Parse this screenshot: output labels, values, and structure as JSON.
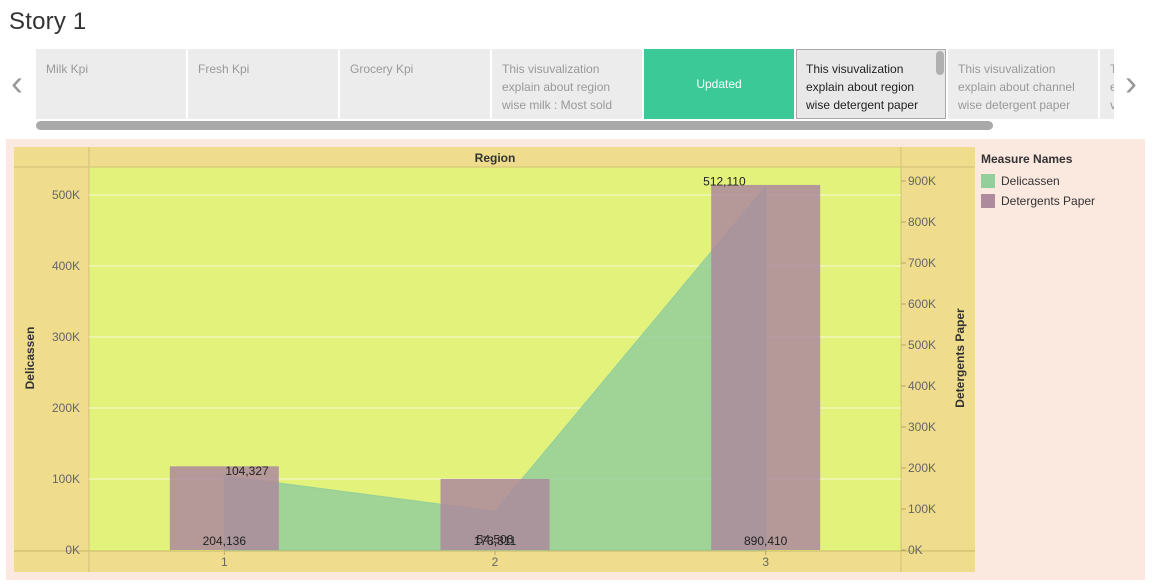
{
  "page": {
    "title": "Story 1"
  },
  "navigator": {
    "prev_icon": "chevron-left-icon",
    "next_icon": "chevron-right-icon",
    "points": [
      {
        "label": "Milk Kpi",
        "state": "normal"
      },
      {
        "label": "Fresh Kpi",
        "state": "normal"
      },
      {
        "label": "Grocery Kpi",
        "state": "normal"
      },
      {
        "label": "This visuvalization explain about  region wise milk : Most sold",
        "state": "normal"
      },
      {
        "label": "Updated",
        "state": "active"
      },
      {
        "label": "This visuvalization explain about  region wise  detergent paper",
        "state": "selected"
      },
      {
        "label": "This visuvalization explain about  channel wise detergent paper",
        "state": "normal"
      },
      {
        "label": "T e v",
        "state": "normal"
      }
    ]
  },
  "colors": {
    "plot_bg": "#e2f27a",
    "axis_bg": "#efdc8c",
    "delicassen": "#93cf9b",
    "detergents": "#ad8a9e",
    "active_point": "#3cc998",
    "dashboard_bg": "#fbe8df"
  },
  "chart_data": {
    "type": "bar",
    "header": "Region",
    "categories": [
      "1",
      "2",
      "3"
    ],
    "series": [
      {
        "name": "Delicassen",
        "mark": "area",
        "axis": "left",
        "values": [
          104327,
          54506,
          512110
        ],
        "labels": [
          "104,327",
          "54,506",
          "512,110"
        ]
      },
      {
        "name": "Detergents Paper",
        "mark": "bar",
        "axis": "right",
        "values": [
          204136,
          173311,
          890410
        ],
        "labels": [
          "204,136",
          "173,311",
          "890,410"
        ]
      }
    ],
    "ylabel_left": "Delicassen",
    "ylabel_right": "Detergents Paper",
    "left_ticks": [
      {
        "v": 0,
        "label": "0K"
      },
      {
        "v": 100000,
        "label": "100K"
      },
      {
        "v": 200000,
        "label": "200K"
      },
      {
        "v": 300000,
        "label": "300K"
      },
      {
        "v": 400000,
        "label": "400K"
      },
      {
        "v": 500000,
        "label": "500K"
      }
    ],
    "right_ticks": [
      {
        "v": 0,
        "label": "0K"
      },
      {
        "v": 100000,
        "label": "100K"
      },
      {
        "v": 200000,
        "label": "200K"
      },
      {
        "v": 300000,
        "label": "300K"
      },
      {
        "v": 400000,
        "label": "400K"
      },
      {
        "v": 500000,
        "label": "500K"
      },
      {
        "v": 600000,
        "label": "600K"
      },
      {
        "v": 700000,
        "label": "700K"
      },
      {
        "v": 800000,
        "label": "800K"
      },
      {
        "v": 900000,
        "label": "900K"
      }
    ],
    "ylim_left": [
      0,
      525000
    ],
    "ylim_right": [
      0,
      945000
    ],
    "grid": true,
    "legend": {
      "title": "Measure Names",
      "position": "right"
    }
  }
}
